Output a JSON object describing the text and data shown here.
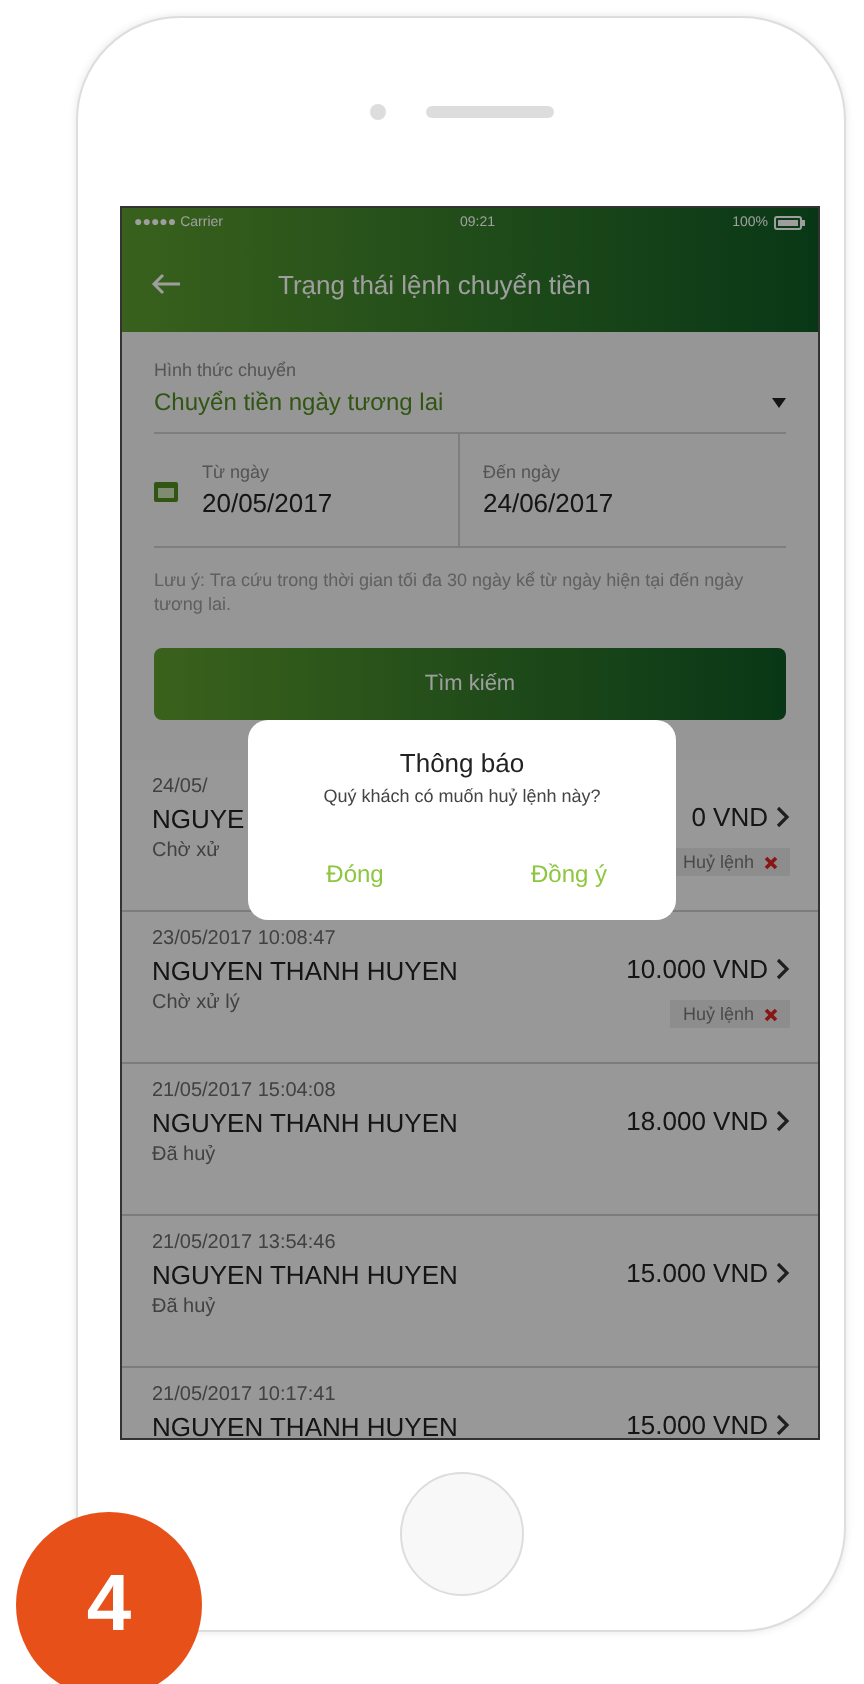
{
  "status_bar": {
    "carrier": "●●●●● Carrier",
    "time": "09:21",
    "battery": "100%"
  },
  "header": {
    "title": "Trạng thái lệnh chuyển tiền"
  },
  "form": {
    "transfer_type": {
      "label": "Hình thức chuyển",
      "value": "Chuyển tiền ngày tương lai"
    },
    "from_date": {
      "label": "Từ ngày",
      "value": "20/05/2017"
    },
    "to_date": {
      "label": "Đến ngày",
      "value": "24/06/2017"
    },
    "note": "Lưu ý: Tra cứu trong thời gian tối đa 30 ngày kể từ ngày hiện tại đến ngày tương lai.",
    "search_button": "Tìm kiếm"
  },
  "orders": [
    {
      "datetime": "24/05/",
      "name": "NGUYE",
      "amount": "0 VND",
      "status": "Chờ xử",
      "cancel_label": "Huỷ lệnh"
    },
    {
      "datetime": "23/05/2017 10:08:47",
      "name": "NGUYEN THANH HUYEN",
      "amount": "10.000 VND",
      "status": "Chờ xử lý",
      "cancel_label": "Huỷ lệnh"
    },
    {
      "datetime": "21/05/2017 15:04:08",
      "name": "NGUYEN THANH HUYEN",
      "amount": "18.000 VND",
      "status": "Đã huỷ"
    },
    {
      "datetime": "21/05/2017 13:54:46",
      "name": "NGUYEN THANH HUYEN",
      "amount": "15.000 VND",
      "status": "Đã huỷ"
    },
    {
      "datetime": "21/05/2017 10:17:41",
      "name": "NGUYEN THANH HUYEN",
      "amount": "15.000 VND"
    }
  ],
  "dialog": {
    "title": "Thông báo",
    "message": "Quý khách có muốn huỷ lệnh này?",
    "buttons": [
      "Đóng",
      "Đồng ý"
    ]
  },
  "step_badge": "4"
}
